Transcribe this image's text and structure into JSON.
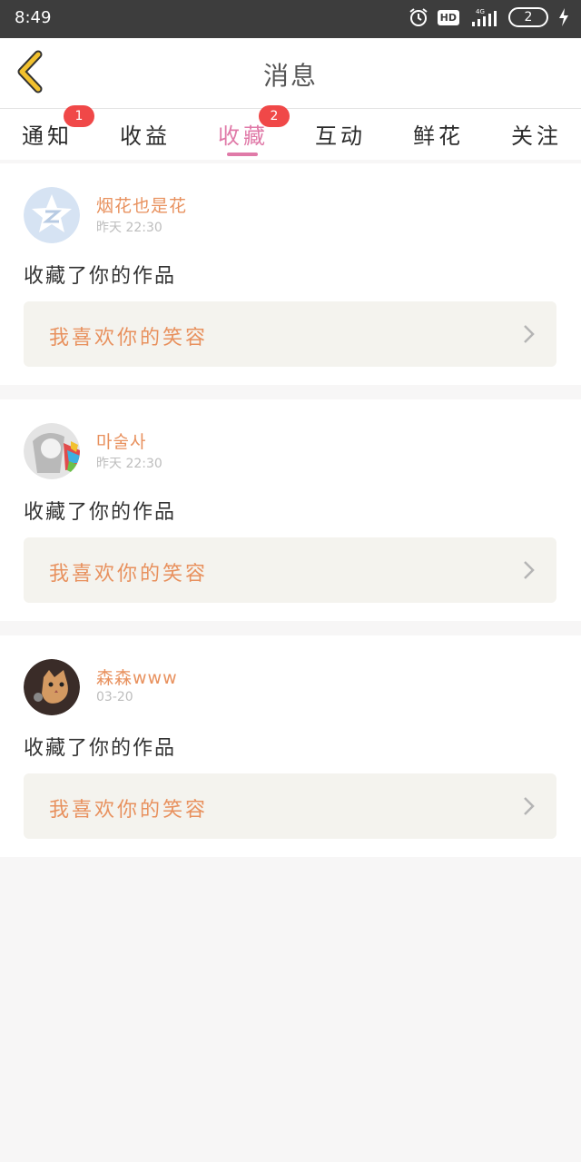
{
  "status_bar": {
    "time": "8:49",
    "hd": "HD",
    "network": "4G",
    "battery": "2"
  },
  "nav": {
    "title": "消息"
  },
  "tabs": [
    {
      "label": "通知",
      "badge": "1"
    },
    {
      "label": "收益"
    },
    {
      "label": "收藏",
      "badge": "2",
      "active": true
    },
    {
      "label": "互动"
    },
    {
      "label": "鲜花"
    },
    {
      "label": "关注"
    }
  ],
  "messages": [
    {
      "user": "烟花也是花",
      "time": "昨天 22:30",
      "action": "收藏了你的作品",
      "work": "我喜欢你的笑容",
      "avatar_icon": "qq-star-avatar"
    },
    {
      "user": "마술사",
      "time": "昨天 22:30",
      "action": "收藏了你的作品",
      "work": "我喜欢你的笑容",
      "avatar_icon": "anime-girl-avatar"
    },
    {
      "user": "森森www",
      "time": "03-20",
      "action": "收藏了你的作品",
      "work": "我喜欢你的笑容",
      "avatar_icon": "cat-avatar"
    }
  ],
  "colors": {
    "accent": "#e07aa8",
    "name": "#e8915e",
    "badge": "#f04848",
    "back": "#f2c12e"
  }
}
